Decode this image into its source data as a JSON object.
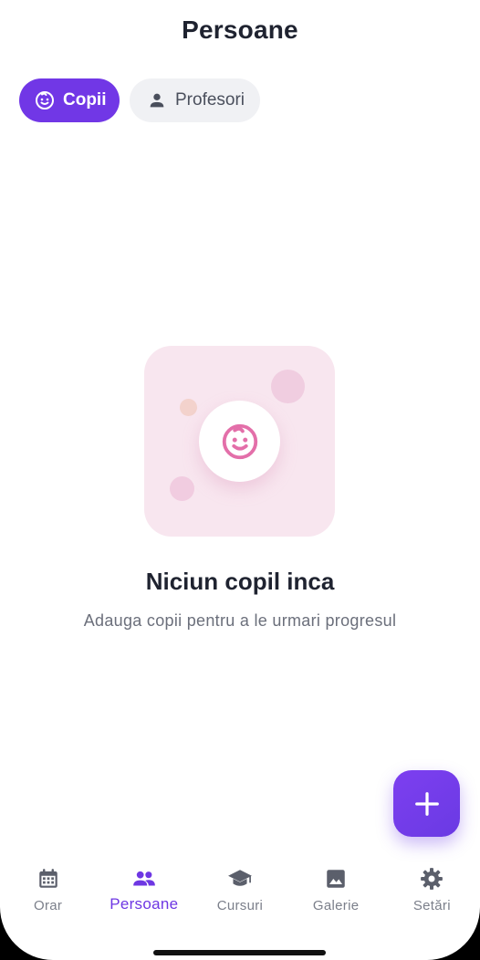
{
  "header": {
    "title": "Persoane"
  },
  "tabs": [
    {
      "label": "Copii",
      "icon": "baby-face-icon",
      "active": true
    },
    {
      "label": "Profesori",
      "icon": "person-icon",
      "active": false
    }
  ],
  "empty_state": {
    "icon": "baby-face-icon",
    "title": "Niciun copil inca",
    "subtitle": "Adauga copii pentru a le urmari progresul"
  },
  "fab": {
    "icon": "plus-icon"
  },
  "bottom_nav": {
    "items": [
      {
        "label": "Orar",
        "icon": "calendar-icon",
        "active": false
      },
      {
        "label": "Persoane",
        "icon": "people-icon",
        "active": true
      },
      {
        "label": "Cursuri",
        "icon": "graduation-cap-icon",
        "active": false
      },
      {
        "label": "Galerie",
        "icon": "image-icon",
        "active": false
      },
      {
        "label": "Setări",
        "icon": "gear-icon",
        "active": false
      }
    ]
  },
  "colors": {
    "accent": "#7137e6",
    "pink": "#e36fa9",
    "text_dark": "#1f2330",
    "text_muted": "#6b6f7b",
    "inactive_nav": "#5b5f6b"
  }
}
